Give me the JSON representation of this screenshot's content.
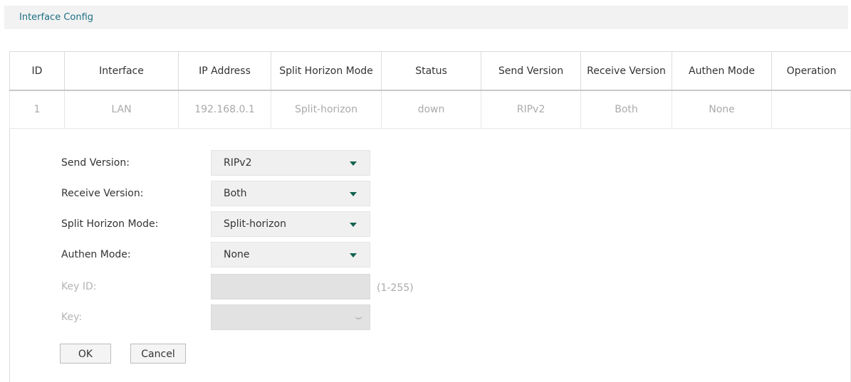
{
  "header": {
    "title": "Interface Config"
  },
  "table": {
    "columns": [
      "ID",
      "Interface",
      "IP Address",
      "Split Horizon Mode",
      "Status",
      "Send Version",
      "Receive Version",
      "Authen Mode",
      "Operation"
    ],
    "rows": [
      [
        "1",
        "LAN",
        "192.168.0.1",
        "Split-horizon",
        "down",
        "RIPv2",
        "Both",
        "None",
        ""
      ]
    ]
  },
  "form": {
    "send_version": {
      "label": "Send Version:",
      "value": "RIPv2"
    },
    "receive_version": {
      "label": "Receive Version:",
      "value": "Both"
    },
    "split_horizon": {
      "label": "Split Horizon Mode:",
      "value": "Split-horizon"
    },
    "authen_mode": {
      "label": "Authen Mode:",
      "value": "None"
    },
    "key_id": {
      "label": "Key ID:",
      "value": "",
      "hint": "(1-255)"
    },
    "key": {
      "label": "Key:",
      "value": ""
    },
    "ok_label": "OK",
    "cancel_label": "Cancel"
  },
  "colors": {
    "header_text": "#1d6f84",
    "caret": "#11624f"
  }
}
